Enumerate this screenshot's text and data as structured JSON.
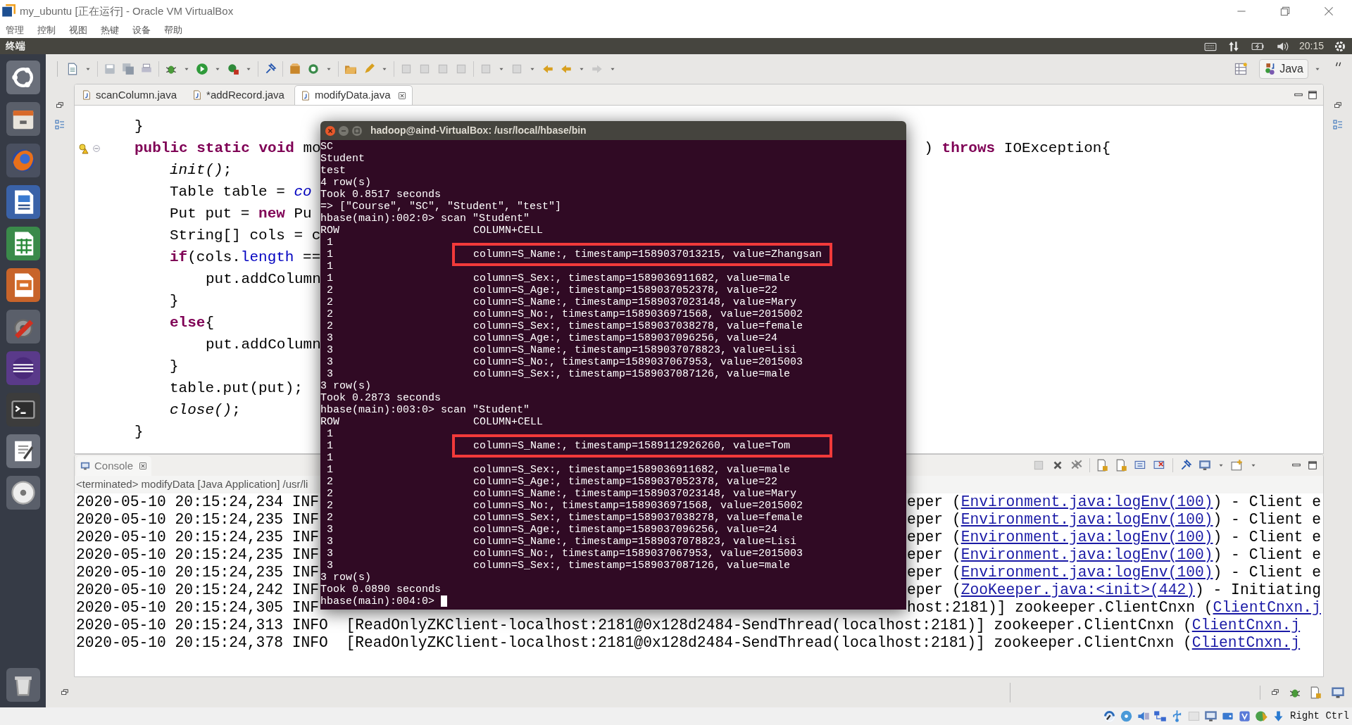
{
  "vbox_window": {
    "title": "my_ubuntu [正在运行] - Oracle VM VirtualBox",
    "menu": [
      "管理",
      "控制",
      "视图",
      "热键",
      "设备",
      "帮助"
    ],
    "host_key": "Right Ctrl"
  },
  "top_panel": {
    "app": "终端",
    "clock": "20:15"
  },
  "eclipse": {
    "perspective": "Java",
    "editor_tabs": [
      {
        "label": "scanColumn.java",
        "selected": false
      },
      {
        "label": "*addRecord.java",
        "selected": false
      },
      {
        "label": "modifyData.java",
        "selected": true
      }
    ],
    "code_lines": [
      {
        "segments": [
          {
            "kind": "plain",
            "text": "}"
          }
        ]
      },
      {
        "segments": [
          {
            "kind": "keyword",
            "text": "public static void"
          },
          {
            "kind": "plain",
            "text": " mo"
          }
        ],
        "right": [
          {
            "kind": "plain",
            "text": ") "
          },
          {
            "kind": "keyword",
            "text": "throws"
          },
          {
            "kind": "plain",
            "text": " IOException{"
          }
        ],
        "children": [
          {
            "segments": [
              {
                "kind": "static_method",
                "text": "init()"
              },
              {
                "kind": "plain",
                "text": ";"
              }
            ]
          },
          {
            "segments": [
              {
                "kind": "plain",
                "text": "Table table = "
              },
              {
                "kind": "static_field",
                "text": "co"
              }
            ]
          },
          {
            "segments": [
              {
                "kind": "plain",
                "text": "Put put = "
              },
              {
                "kind": "keyword",
                "text": "new"
              },
              {
                "kind": "plain",
                "text": " Pu"
              }
            ]
          },
          {
            "segments": [
              {
                "kind": "plain",
                "text": "String[] cols = c"
              }
            ]
          },
          {
            "segments": [
              {
                "kind": "keyword",
                "text": "if"
              },
              {
                "kind": "plain",
                "text": "(cols."
              },
              {
                "kind": "field",
                "text": "length"
              },
              {
                "kind": "plain",
                "text": " =="
              }
            ],
            "children": [
              {
                "segments": [
                  {
                    "kind": "plain",
                    "text": "put.addColumn"
                  }
                ]
              }
            ]
          },
          {
            "segments": [
              {
                "kind": "plain",
                "text": "}"
              }
            ]
          },
          {
            "segments": [
              {
                "kind": "keyword",
                "text": "else"
              },
              {
                "kind": "plain",
                "text": "{"
              }
            ],
            "children": [
              {
                "segments": [
                  {
                    "kind": "plain",
                    "text": "put.addColumn"
                  }
                ]
              }
            ]
          },
          {
            "segments": [
              {
                "kind": "plain",
                "text": "}"
              }
            ]
          },
          {
            "segments": [
              {
                "kind": "plain",
                "text": "table.put(put);"
              }
            ]
          },
          {
            "segments": [
              {
                "kind": "static_method",
                "text": "close()"
              },
              {
                "kind": "plain",
                "text": ";"
              }
            ]
          }
        ]
      },
      {
        "segments": [
          {
            "kind": "plain",
            "text": "}"
          }
        ]
      }
    ],
    "console": {
      "tab": "Console",
      "header": "<terminated> modifyData [Java Application] /usr/li",
      "lines": [
        {
          "kind": "split",
          "left": "2020-05-10 20:15:24,234 INF",
          "before": "eper (",
          "link": "Environment.java:logEnv(100)",
          "after": ") - Client e"
        },
        {
          "kind": "split",
          "left": "2020-05-10 20:15:24,235 INF",
          "before": "eper (",
          "link": "Environment.java:logEnv(100)",
          "after": ") - Client e"
        },
        {
          "kind": "split",
          "left": "2020-05-10 20:15:24,235 INF",
          "before": "eper (",
          "link": "Environment.java:logEnv(100)",
          "after": ") - Client e"
        },
        {
          "kind": "split",
          "left": "2020-05-10 20:15:24,235 INF",
          "before": "eper (",
          "link": "Environment.java:logEnv(100)",
          "after": ") - Client e"
        },
        {
          "kind": "split",
          "left": "2020-05-10 20:15:24,235 INF",
          "before": "eper (",
          "link": "Environment.java:logEnv(100)",
          "after": ") - Client e"
        },
        {
          "kind": "split",
          "left": "2020-05-10 20:15:24,242 INF",
          "before": "eper (",
          "link": "ZooKeeper.java:<init>(442)",
          "after": ") - Initiating"
        },
        {
          "kind": "split",
          "left": "2020-05-10 20:15:24,305 INF",
          "before": "host:2181)] zookeeper.ClientCnxn (",
          "link": "ClientCnxn.j"
        },
        {
          "kind": "full",
          "before": "2020-05-10 20:15:24,313 INFO  [ReadOnlyZKClient-localhost:2181@0x128d2484-SendThread(localhost:2181)] zookeeper.ClientCnxn (",
          "link": "ClientCnxn.j"
        },
        {
          "kind": "full",
          "before": "2020-05-10 20:15:24,378 INFO  [ReadOnlyZKClient-localhost:2181@0x128d2484-SendThread(localhost:2181)] zookeeper.ClientCnxn (",
          "link": "ClientCnxn.j"
        }
      ]
    }
  },
  "terminal": {
    "title": "hadoop@aind-VirtualBox: /usr/local/hbase/bin",
    "cursor": true,
    "lines": [
      {
        "kind": "text",
        "text": "SC"
      },
      {
        "kind": "text",
        "text": "Student"
      },
      {
        "kind": "text",
        "text": "test"
      },
      {
        "kind": "text",
        "text": "4 row(s)"
      },
      {
        "kind": "text",
        "text": "Took 0.8517 seconds"
      },
      {
        "kind": "text",
        "text": "=> [\"Course\", \"SC\", \"Student\", \"test\"]"
      },
      {
        "kind": "text",
        "text": "hbase(main):002:0> scan \"Student\""
      },
      {
        "kind": "header",
        "row": "ROW",
        "cell": "COLUMN+CELL"
      },
      {
        "kind": "row",
        "row": "1",
        "highlighted": false
      },
      {
        "kind": "row",
        "row": "1",
        "cell": "column=S_Name:, timestamp=1589037013215, value=Zhangsan",
        "highlighted": true
      },
      {
        "kind": "row",
        "row": "1",
        "highlighted": false
      },
      {
        "kind": "row",
        "row": "1",
        "cell": "column=S_Sex:, timestamp=1589036911682, value=male",
        "highlighted": false
      },
      {
        "kind": "row",
        "row": "2",
        "cell": "column=S_Age:, timestamp=1589037052378, value=22",
        "highlighted": false
      },
      {
        "kind": "row",
        "row": "2",
        "cell": "column=S_Name:, timestamp=1589037023148, value=Mary",
        "highlighted": false
      },
      {
        "kind": "row",
        "row": "2",
        "cell": "column=S_No:, timestamp=1589036971568, value=2015002",
        "highlighted": false
      },
      {
        "kind": "row",
        "row": "2",
        "cell": "column=S_Sex:, timestamp=1589037038278, value=female",
        "highlighted": false
      },
      {
        "kind": "row",
        "row": "3",
        "cell": "column=S_Age:, timestamp=1589037096256, value=24",
        "highlighted": false
      },
      {
        "kind": "row",
        "row": "3",
        "cell": "column=S_Name:, timestamp=1589037078823, value=Lisi",
        "highlighted": false
      },
      {
        "kind": "row",
        "row": "3",
        "cell": "column=S_No:, timestamp=1589037067953, value=2015003",
        "highlighted": false
      },
      {
        "kind": "row",
        "row": "3",
        "cell": "column=S_Sex:, timestamp=1589037087126, value=male",
        "highlighted": false
      },
      {
        "kind": "text",
        "text": "3 row(s)"
      },
      {
        "kind": "text",
        "text": "Took 0.2873 seconds"
      },
      {
        "kind": "text",
        "text": "hbase(main):003:0> scan \"Student\""
      },
      {
        "kind": "header",
        "row": "ROW",
        "cell": "COLUMN+CELL"
      },
      {
        "kind": "row",
        "row": "1",
        "highlighted": false
      },
      {
        "kind": "row",
        "row": "1",
        "cell": "column=S_Name:, timestamp=1589112926260, value=Tom",
        "highlighted": true
      },
      {
        "kind": "row",
        "row": "1",
        "highlighted": false
      },
      {
        "kind": "row",
        "row": "1",
        "cell": "column=S_Sex:, timestamp=1589036911682, value=male",
        "highlighted": false
      },
      {
        "kind": "row",
        "row": "2",
        "cell": "column=S_Age:, timestamp=1589037052378, value=22",
        "highlighted": false
      },
      {
        "kind": "row",
        "row": "2",
        "cell": "column=S_Name:, timestamp=1589037023148, value=Mary",
        "highlighted": false
      },
      {
        "kind": "row",
        "row": "2",
        "cell": "column=S_No:, timestamp=1589036971568, value=2015002",
        "highlighted": false
      },
      {
        "kind": "row",
        "row": "2",
        "cell": "column=S_Sex:, timestamp=1589037038278, value=female",
        "highlighted": false
      },
      {
        "kind": "row",
        "row": "3",
        "cell": "column=S_Age:, timestamp=1589037096256, value=24",
        "highlighted": false
      },
      {
        "kind": "row",
        "row": "3",
        "cell": "column=S_Name:, timestamp=1589037078823, value=Lisi",
        "highlighted": false
      },
      {
        "kind": "row",
        "row": "3",
        "cell": "column=S_No:, timestamp=1589037067953, value=2015003",
        "highlighted": false
      },
      {
        "kind": "row",
        "row": "3",
        "cell": "column=S_Sex:, timestamp=1589037087126, value=male",
        "highlighted": false
      },
      {
        "kind": "text",
        "text": "3 row(s)"
      },
      {
        "kind": "text",
        "text": "Took 0.0890 seconds"
      },
      {
        "kind": "prompt",
        "text": "hbase(main):004:0>"
      }
    ]
  }
}
